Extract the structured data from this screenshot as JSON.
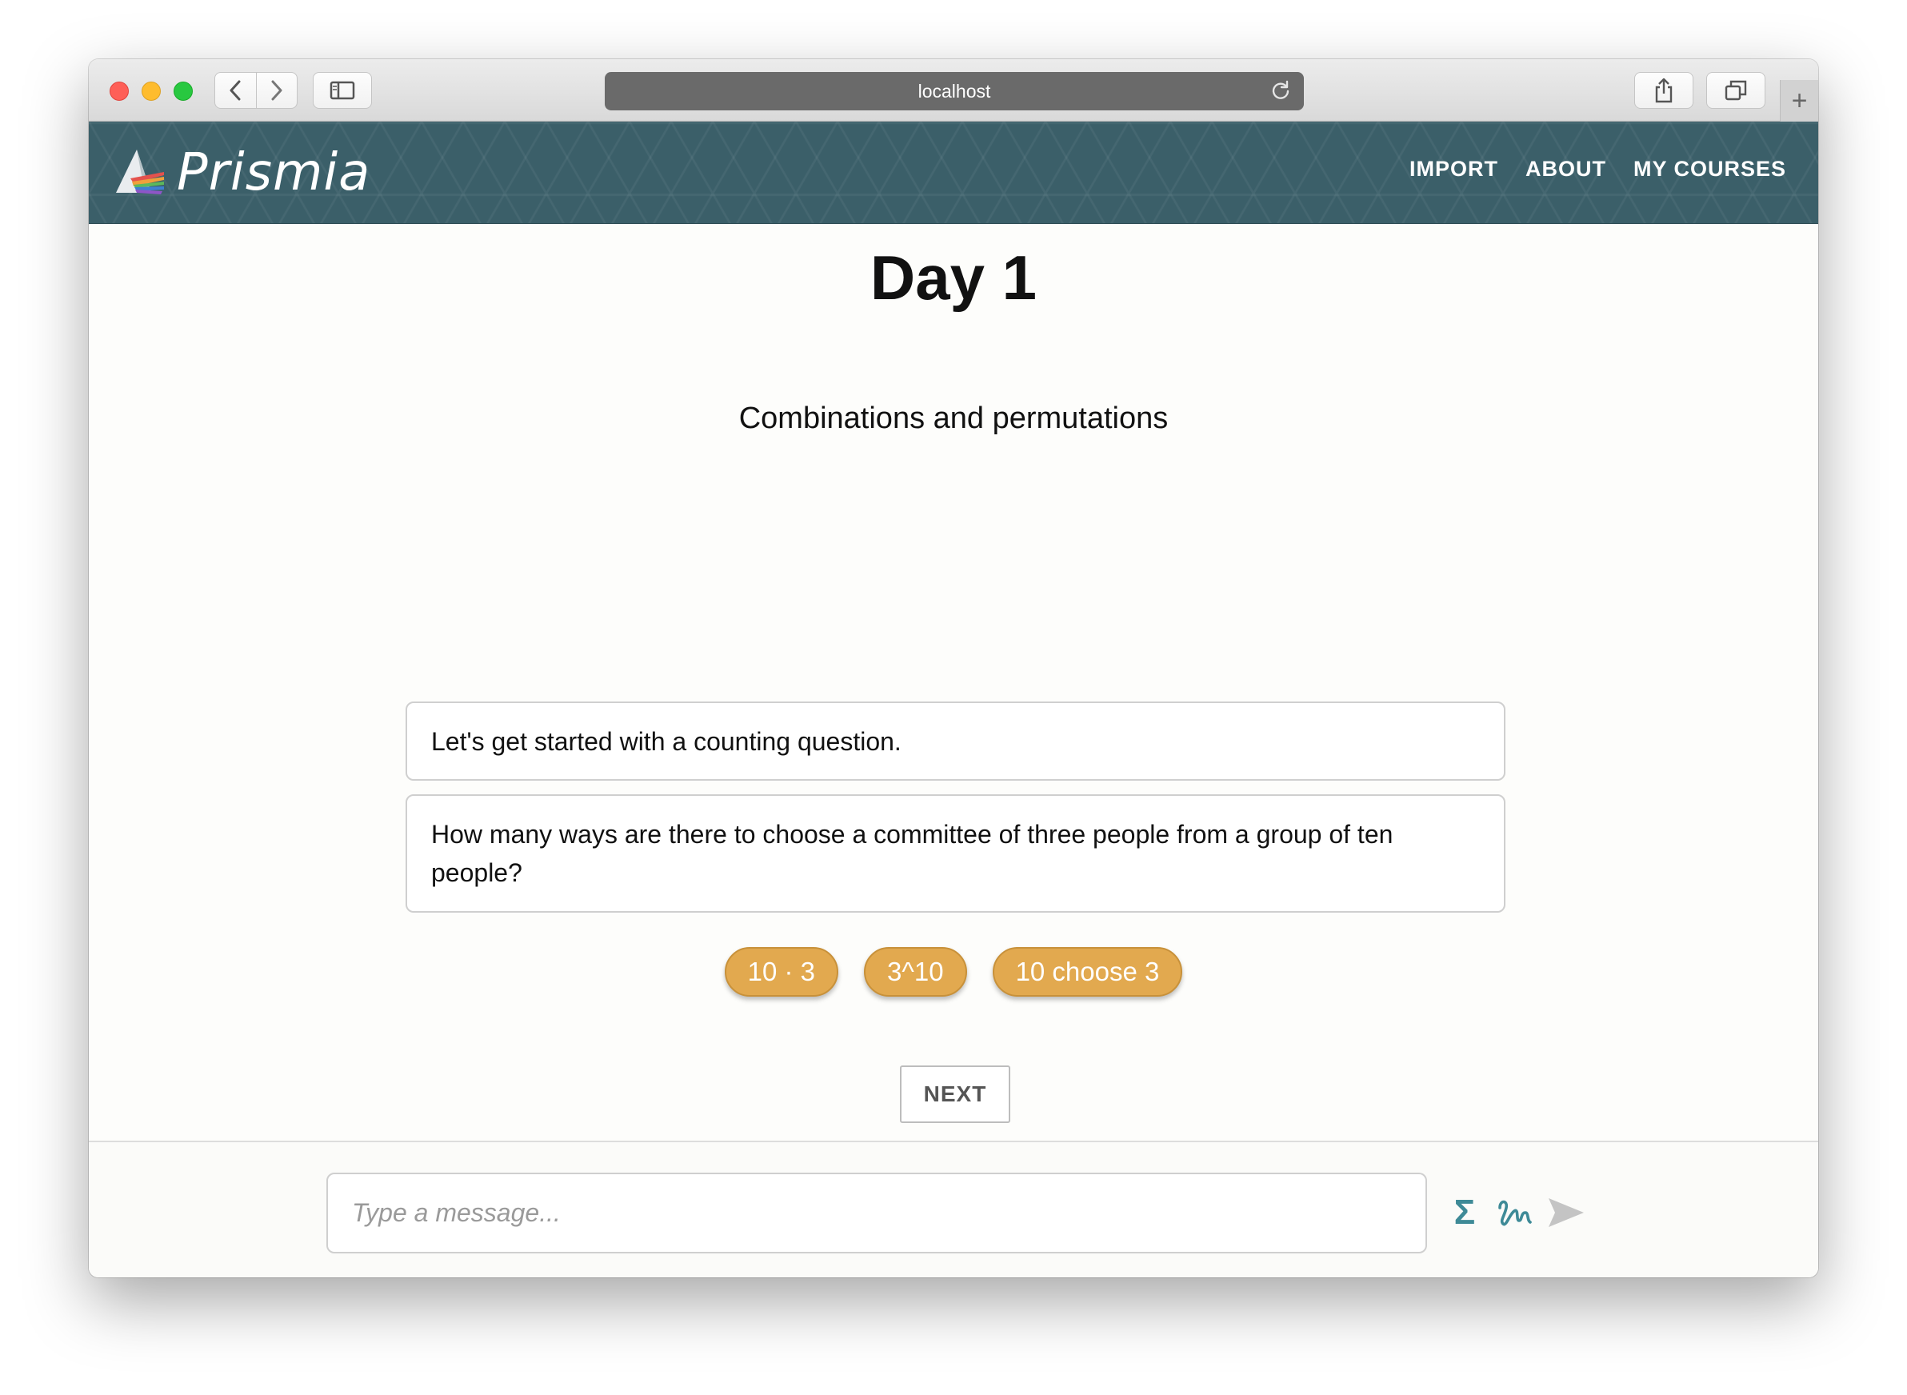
{
  "browser": {
    "url": "localhost",
    "icons": {
      "back": "chevron-left-icon",
      "forward": "chevron-right-icon",
      "sidebar": "sidebar-icon",
      "reload": "reload-icon",
      "share": "share-icon",
      "tabs": "tabs-icon",
      "new_tab": "plus-icon"
    },
    "new_tab_glyph": "+"
  },
  "header": {
    "brand": "Prismia",
    "brand_color": "#3b5f69",
    "nav": [
      "IMPORT",
      "ABOUT",
      "MY COURSES"
    ]
  },
  "page": {
    "title": "Day 1",
    "subtitle": "Combinations and permutations"
  },
  "messages": [
    "Let's get started with a counting question.",
    "How many ways are there to choose a committee of three people from a group of ten people?"
  ],
  "choices": {
    "color": "#e2a94f",
    "items": [
      "10 · 3",
      "3^10",
      "10 choose 3"
    ]
  },
  "next_label": "NEXT",
  "composer": {
    "placeholder": "Type a message...",
    "sigma_glyph": "Σ",
    "icons": [
      "sigma-icon",
      "scribble-icon",
      "send-icon"
    ]
  }
}
